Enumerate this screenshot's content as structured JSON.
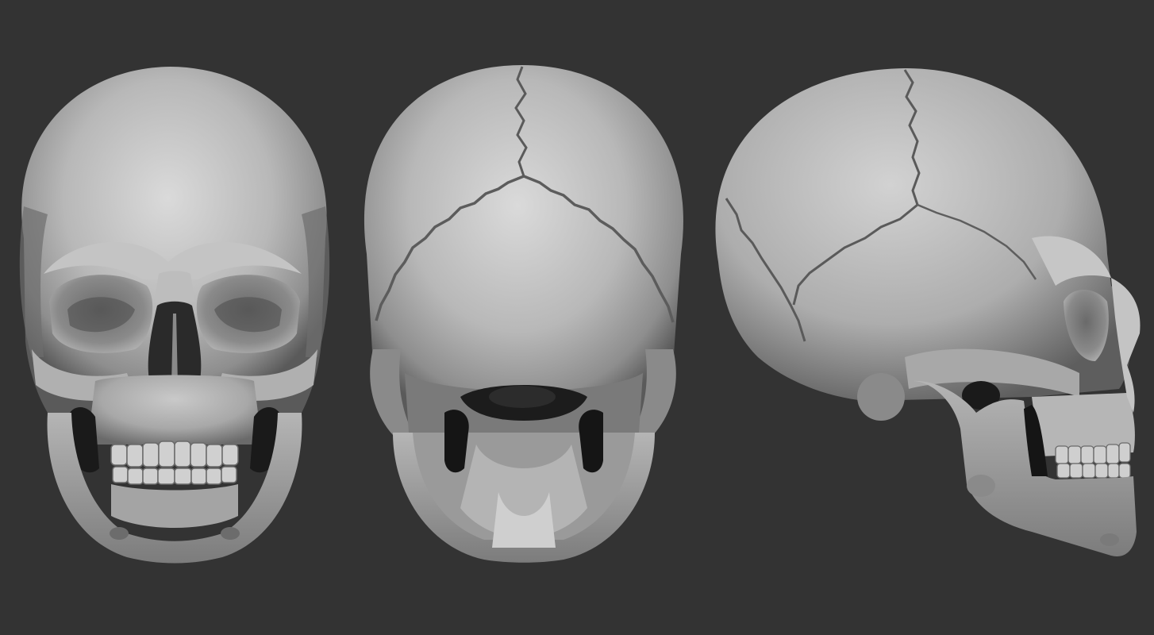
{
  "scene": {
    "description_free": true,
    "background_color": "#333333",
    "bone_light": "#d4d4d4",
    "bone_mid": "#9a9a9a",
    "bone_dark": "#3c3c3c",
    "cavity_color": "#141414",
    "suture_color": "#5a5a5a",
    "views": [
      {
        "id": "front",
        "icon": "skull-front-view"
      },
      {
        "id": "back",
        "icon": "skull-back-view"
      },
      {
        "id": "side",
        "icon": "skull-side-view"
      }
    ]
  }
}
